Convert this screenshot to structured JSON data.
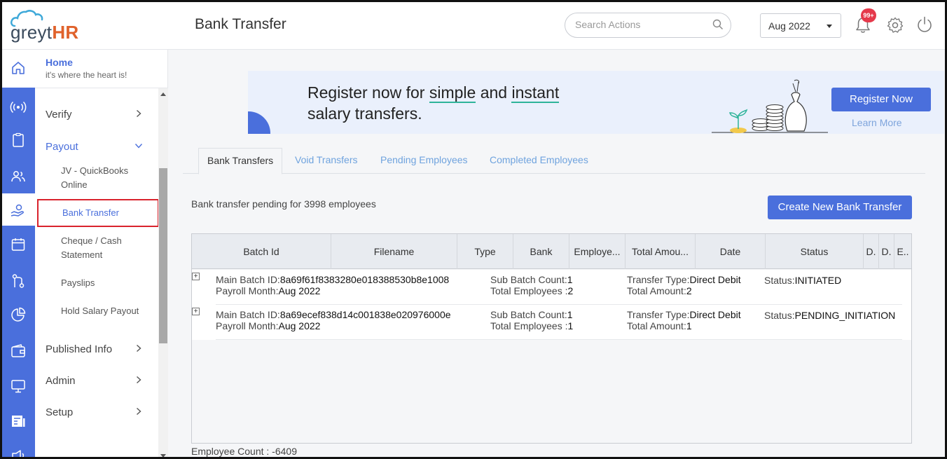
{
  "brand": {
    "logo_main": "greyt",
    "logo_accent": "HR"
  },
  "header": {
    "title": "Bank Transfer",
    "search_placeholder": "Search Actions",
    "month": "Aug 2022",
    "notification_count": "99+"
  },
  "sidebar": {
    "home_title": "Home",
    "home_subtitle": "it's where the heart is!",
    "items": [
      {
        "label": "Verify"
      },
      {
        "label": "Payout"
      },
      {
        "label": "Published Info"
      },
      {
        "label": "Admin"
      },
      {
        "label": "Setup"
      }
    ],
    "payout_sub": [
      {
        "label": "JV - QuickBooks Online"
      },
      {
        "label": "Bank Transfer"
      },
      {
        "label": "Cheque / Cash Statement"
      },
      {
        "label": "Payslips"
      },
      {
        "label": "Hold Salary Payout"
      }
    ],
    "rail_icons": [
      "home-icon",
      "radio-icon",
      "clipboard-icon",
      "people-icon",
      "payout-hand-icon",
      "calendar-icon",
      "workflow-icon",
      "pie-chart-icon",
      "wallet-icon",
      "monitor-icon",
      "document-icon",
      "megaphone-icon"
    ]
  },
  "banner": {
    "line1_pre": "Register now for ",
    "line1_em1": "simple",
    "line1_mid": " and ",
    "line1_em2": "instant",
    "line2": "salary transfers.",
    "register_button": "Register Now",
    "learn_more": "Learn More"
  },
  "tabs": [
    "Bank Transfers",
    "Void Transfers",
    "Pending Employees",
    "Completed Employees"
  ],
  "pending_text": "Bank transfer pending for 3998 employees",
  "create_button": "Create New Bank Transfer",
  "grid": {
    "columns": [
      "Batch Id",
      "Filename",
      "Type",
      "Bank",
      "Employe...",
      "Total Amou...",
      "Date",
      "Status",
      "D.",
      "D.",
      "E.."
    ],
    "rows": [
      {
        "main_batch_label": "Main Batch ID:",
        "main_batch_id": "8a69f61f8383280e018388530b8e1008",
        "payroll_label": "Payroll Month:",
        "payroll_month": "Aug 2022",
        "sub_batch_label": "Sub Batch Count:",
        "sub_batch_count": "1",
        "total_emp_label": "Total Employees :",
        "total_employees": "2",
        "transfer_type_label": "Transfer Type:",
        "transfer_type": "Direct Debit",
        "total_amount_label": "Total Amount:",
        "total_amount": "2",
        "status_label": "Status:",
        "status": "INITIATED"
      },
      {
        "main_batch_label": "Main Batch ID:",
        "main_batch_id": "8a69ecef838d14c001838e020976000e",
        "payroll_label": "Payroll Month:",
        "payroll_month": "Aug 2022",
        "sub_batch_label": "Sub Batch Count:",
        "sub_batch_count": "1",
        "total_emp_label": "Total Employees :",
        "total_employees": "1",
        "transfer_type_label": "Transfer Type:",
        "transfer_type": "Direct Debit",
        "total_amount_label": "Total Amount:",
        "total_amount": "1",
        "status_label": "Status:",
        "status": "PENDING_INITIATION"
      }
    ],
    "expand_symbol": "+"
  },
  "employee_count": "Employee Count : -6409",
  "colors": {
    "brand_blue": "#4a6fdc",
    "link_blue": "#6fa3de",
    "highlight_red": "#d9232d",
    "accent_green": "#2fb49a",
    "badge_red": "#e5394b"
  }
}
